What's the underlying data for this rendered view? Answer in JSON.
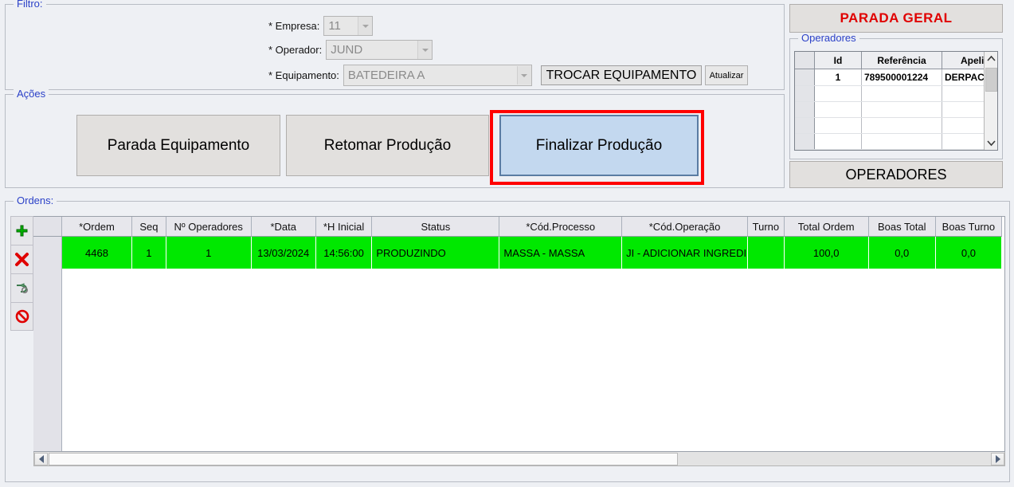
{
  "colors": {
    "accent_blue_label": "#2b41c8",
    "highlight_red": "#ff0000",
    "row_green": "#00e800",
    "selected_button_blue": "#c3d8ef",
    "parada_geral_red": "#e00000",
    "window_bg": "#eef0f4"
  },
  "filtro": {
    "legend": "Filtro:",
    "empresa_label": "* Empresa:",
    "empresa_value": "11",
    "operador_label": "* Operador:",
    "operador_value": "JUND",
    "equipamento_label": "* Equipamento:",
    "equipamento_value": "BATEDEIRA A",
    "trocar_equipamento_label": "TROCAR EQUIPAMENTO",
    "atualizar_label": "Atualizar"
  },
  "acoes": {
    "legend": "Ações",
    "parada_equipamento_label": "Parada Equipamento",
    "retomar_producao_label": "Retomar Produção",
    "finalizar_producao_label": "Finalizar Produção"
  },
  "right_panel": {
    "parada_geral_label": "PARADA GERAL",
    "operadores_legend": "Operadores",
    "operadores_button_label": "OPERADORES",
    "operadores_grid": {
      "columns": [
        "",
        "Id",
        "Referência",
        "Apelido"
      ],
      "rows": [
        {
          "sel": "",
          "id": "1",
          "referencia": "789500001224",
          "apelido": "DERPAC"
        }
      ],
      "blank_rows": 4
    }
  },
  "ordens": {
    "legend": "Ordens:",
    "toolbar": [
      {
        "name": "add-row-icon",
        "title": "Adicionar"
      },
      {
        "name": "delete-row-icon",
        "title": "Excluir"
      },
      {
        "name": "undo-row-icon",
        "title": "Desfazer"
      },
      {
        "name": "cancel-row-icon",
        "title": "Cancelar"
      }
    ],
    "columns": [
      {
        "key": "sel",
        "label": "",
        "width": 34,
        "align": "center"
      },
      {
        "key": "ordem",
        "label": "*Ordem",
        "width": 85,
        "align": "center"
      },
      {
        "key": "seq",
        "label": "Seq",
        "width": 41,
        "align": "center"
      },
      {
        "key": "n_oper",
        "label": "Nº Operadores",
        "width": 103,
        "align": "center"
      },
      {
        "key": "data",
        "label": "*Data",
        "width": 78,
        "align": "center"
      },
      {
        "key": "h_inicial",
        "label": "*H Inicial",
        "width": 68,
        "align": "center"
      },
      {
        "key": "status",
        "label": "Status",
        "width": 154,
        "align": "left"
      },
      {
        "key": "cod_proc",
        "label": "*Cód.Processo",
        "width": 148,
        "align": "left"
      },
      {
        "key": "cod_oper",
        "label": "*Cód.Operação",
        "width": 152,
        "align": "left"
      },
      {
        "key": "turno",
        "label": "Turno",
        "width": 44,
        "align": "center"
      },
      {
        "key": "total",
        "label": "Total Ordem",
        "width": 102,
        "align": "center"
      },
      {
        "key": "boas_total",
        "label": "Boas Total",
        "width": 81,
        "align": "center"
      },
      {
        "key": "boas_turno",
        "label": "Boas Turno",
        "width": 80,
        "align": "center"
      }
    ],
    "rows": [
      {
        "sel": "",
        "ordem": "4468",
        "seq": "1",
        "n_oper": "1",
        "data": "13/03/2024",
        "h_inicial": "14:56:00",
        "status": "PRODUZINDO",
        "cod_proc": "MASSA  -  MASSA",
        "cod_oper": "JI  -  ADICIONAR INGREDI",
        "turno": "",
        "total": "100,0",
        "boas_total": "0,0",
        "boas_turno": "0,0"
      }
    ]
  }
}
